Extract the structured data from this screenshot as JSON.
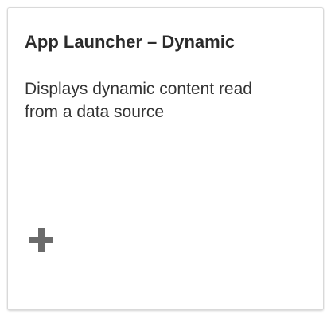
{
  "tile": {
    "title": "App Launcher – Dynamic",
    "subtitle": "Displays dynamic content read from a data source",
    "icon": "plus-icon",
    "colors": {
      "title": "#2b2b2b",
      "subtitle": "#333333",
      "icon": "#6b6b6b",
      "border": "#d9d9d9"
    }
  }
}
